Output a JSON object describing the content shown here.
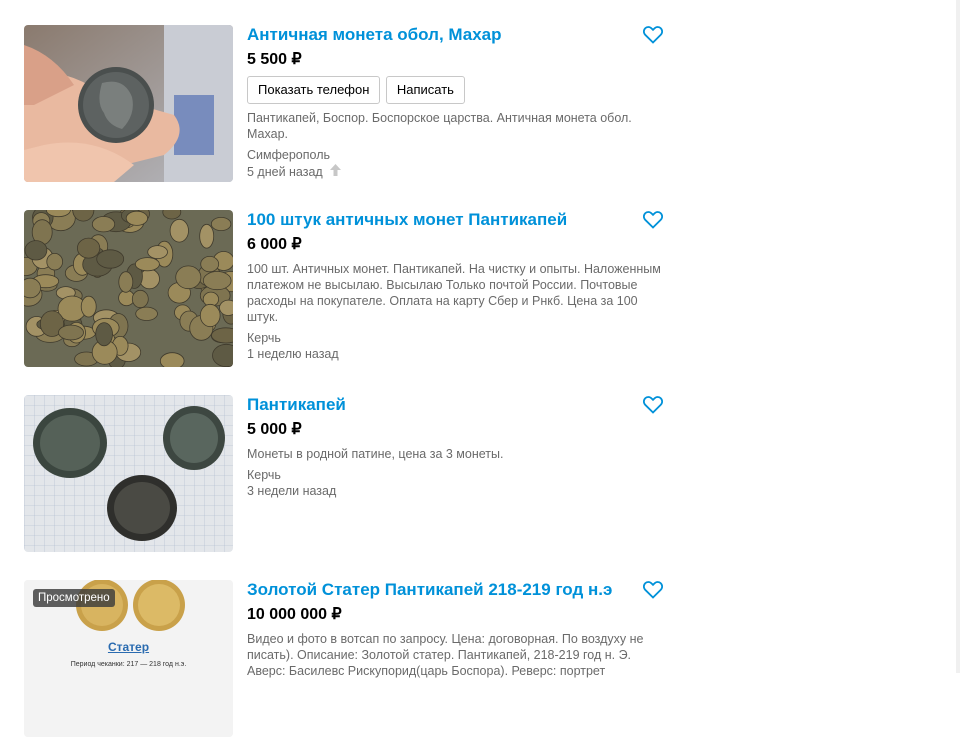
{
  "listings": [
    {
      "title": "Античная монета обол, Махар",
      "price": "5 500 ₽",
      "phone_button": "Показать телефон",
      "write_button": "Написать",
      "description": "Пантикапей, Боспор. Боспорское царства. Античная монета обол. Махар.",
      "city": "Симферополь",
      "date": "5 дней назад"
    },
    {
      "title": "100 штук античных монет Пантикапей",
      "price": "6 000 ₽",
      "description": "100 шт. Античных монет. Пантикапей. На чистку и опыты. Наложенным платежом не высылаю. Высылаю Только почтой России. Почтовые расходы на покупателе. Оплата на карту Сбер и Рнкб. Цена за 100 штук.",
      "city": "Керчь",
      "date": "1 неделю назад"
    },
    {
      "title": "Пантикапей",
      "price": "5 000 ₽",
      "description": "Монеты в родной патине, цена за 3 монеты.",
      "city": "Керчь",
      "date": "3 недели назад"
    },
    {
      "title": "Золотой Статер Пантикапей 218-219 год н.э",
      "price": "10 000 000 ₽",
      "viewed_badge": "Просмотрено",
      "thumb_caption": "Статер",
      "thumb_subcaption": "Период чеканки: 217 — 218 год н.э.",
      "description": "Видео и фото в вотсап по запросу. Цена: договорная. По воздуху не писать). Описание: Золотой статер. Пантикапей, 218-219 год н. Э. Аверс: Басилевс Рискупорид(царь Боспора). Реверс: портрет"
    }
  ],
  "colors": {
    "link": "#0091d9",
    "muted": "#6a6a6a"
  },
  "icons": {
    "favorite": "heart-outline-icon",
    "raised": "up-arrow-icon"
  }
}
